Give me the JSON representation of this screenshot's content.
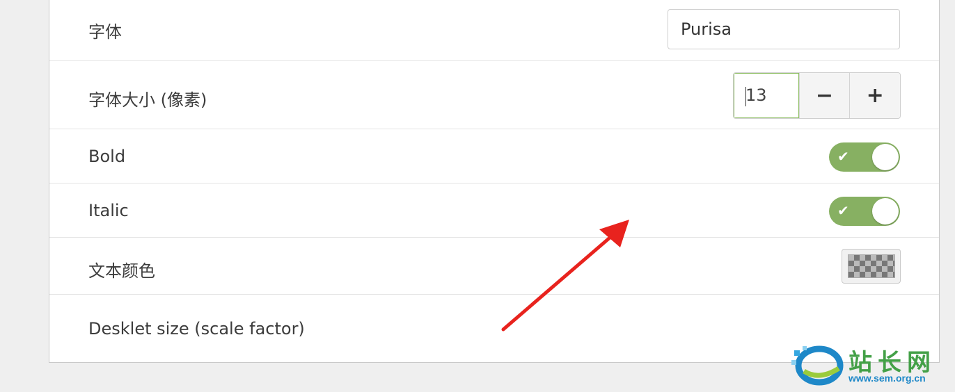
{
  "settings": {
    "font": {
      "label": "字体",
      "value": "Purisa"
    },
    "font_size": {
      "label": "字体大小 (像素)",
      "value": "13",
      "decrement": "−",
      "increment": "+"
    },
    "bold": {
      "label": "Bold",
      "enabled": true,
      "check_glyph": "✔"
    },
    "italic": {
      "label": "Italic",
      "enabled": true,
      "check_glyph": "✔"
    },
    "text_color": {
      "label": "文本颜色"
    },
    "desklet_size": {
      "label": "Desklet size (scale factor)"
    }
  },
  "watermark": {
    "brand": "站长网",
    "url": "www.sem.org.cn"
  },
  "colors": {
    "toggle_on": "#87b062",
    "annotation_arrow": "#e8231e"
  }
}
